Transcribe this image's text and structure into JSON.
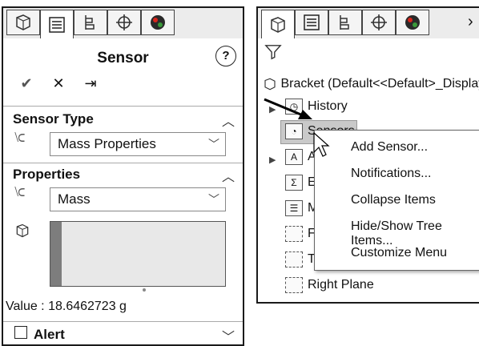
{
  "left_panel": {
    "tabs": [
      "feature-manager-tab",
      "property-manager-tab",
      "configuration-manager-tab",
      "dimxpert-tab",
      "display-manager-tab"
    ],
    "title": "Sensor",
    "help": "?",
    "actions": {
      "ok": "✔",
      "cancel": "✕",
      "pin": "⇥"
    },
    "sensor_type": {
      "label": "Sensor Type",
      "value": "Mass Properties"
    },
    "properties": {
      "label": "Properties",
      "value": "Mass"
    },
    "value_text": "Value : 18.6462723 g",
    "alert": {
      "label": "Alert",
      "checked": false
    }
  },
  "right_panel": {
    "tree": {
      "root": "Bracket  (Default<<Default>_Display",
      "items": [
        "History",
        "Sensors",
        "A",
        "E",
        "M",
        "F",
        "T",
        "Right Plane"
      ]
    },
    "context_menu": [
      "Add Sensor...",
      "Notifications...",
      "Collapse Items",
      "Hide/Show Tree Items...",
      "Customize Menu"
    ]
  },
  "colors": {
    "accent_red": "#d9251c",
    "selection": "#c9c9c9"
  }
}
